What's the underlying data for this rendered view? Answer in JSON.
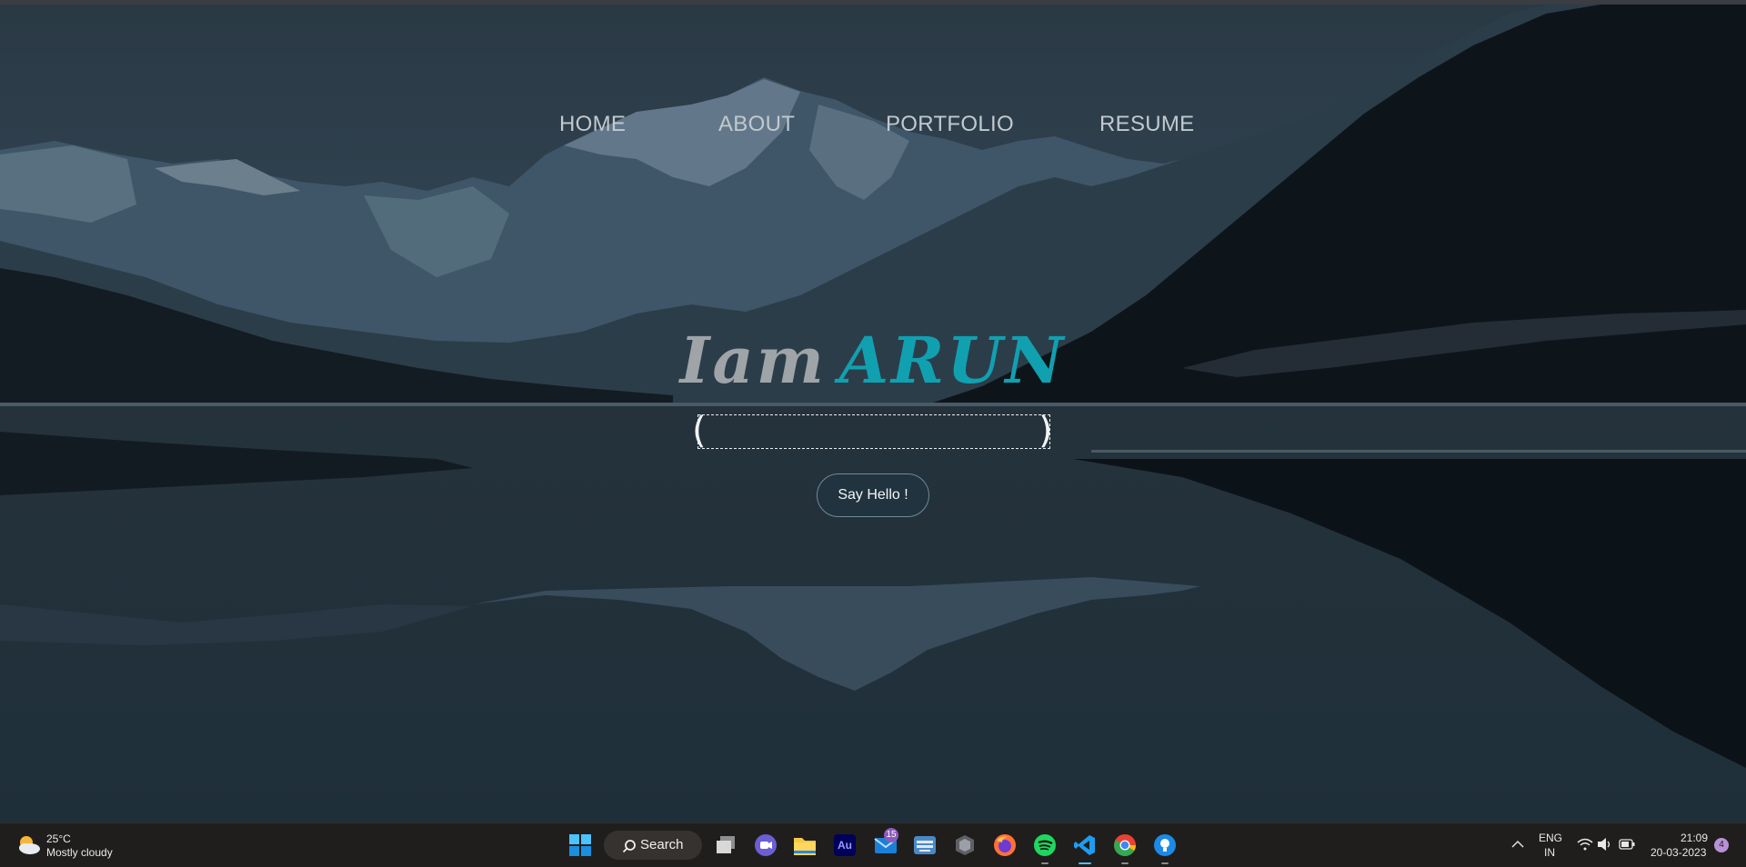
{
  "nav": {
    "items": [
      {
        "label": "HOME"
      },
      {
        "label": "ABOUT"
      },
      {
        "label": "PORTFOLIO"
      },
      {
        "label": "RESUME"
      }
    ]
  },
  "hero": {
    "headline_part1": "Iam",
    "headline_part2": "ARUN",
    "typed_text": "",
    "button_label": "Say Hello !",
    "colors": {
      "accent": "#11a0b0",
      "muted": "#9ea4a8"
    }
  },
  "taskbar": {
    "weather": {
      "temp": "25°C",
      "desc": "Mostly cloudy",
      "icon": "partly-cloudy-icon"
    },
    "search_label": "Search",
    "apps": [
      {
        "name": "windows-start-icon"
      },
      {
        "name": "task-view-icon"
      },
      {
        "name": "teams-chat-icon"
      },
      {
        "name": "file-explorer-icon"
      },
      {
        "name": "adobe-audition-icon",
        "text": "Au"
      },
      {
        "name": "mail-icon",
        "badge": "15"
      },
      {
        "name": "keyboard-app-icon"
      },
      {
        "name": "cube-app-icon"
      },
      {
        "name": "firefox-icon"
      },
      {
        "name": "spotify-icon"
      },
      {
        "name": "vscode-icon"
      },
      {
        "name": "chrome-icon"
      },
      {
        "name": "lightbulb-app-icon"
      }
    ],
    "tray": {
      "lang": "ENG",
      "region": "IN",
      "time": "21:09",
      "date": "20-03-2023",
      "notifications": "4"
    }
  }
}
